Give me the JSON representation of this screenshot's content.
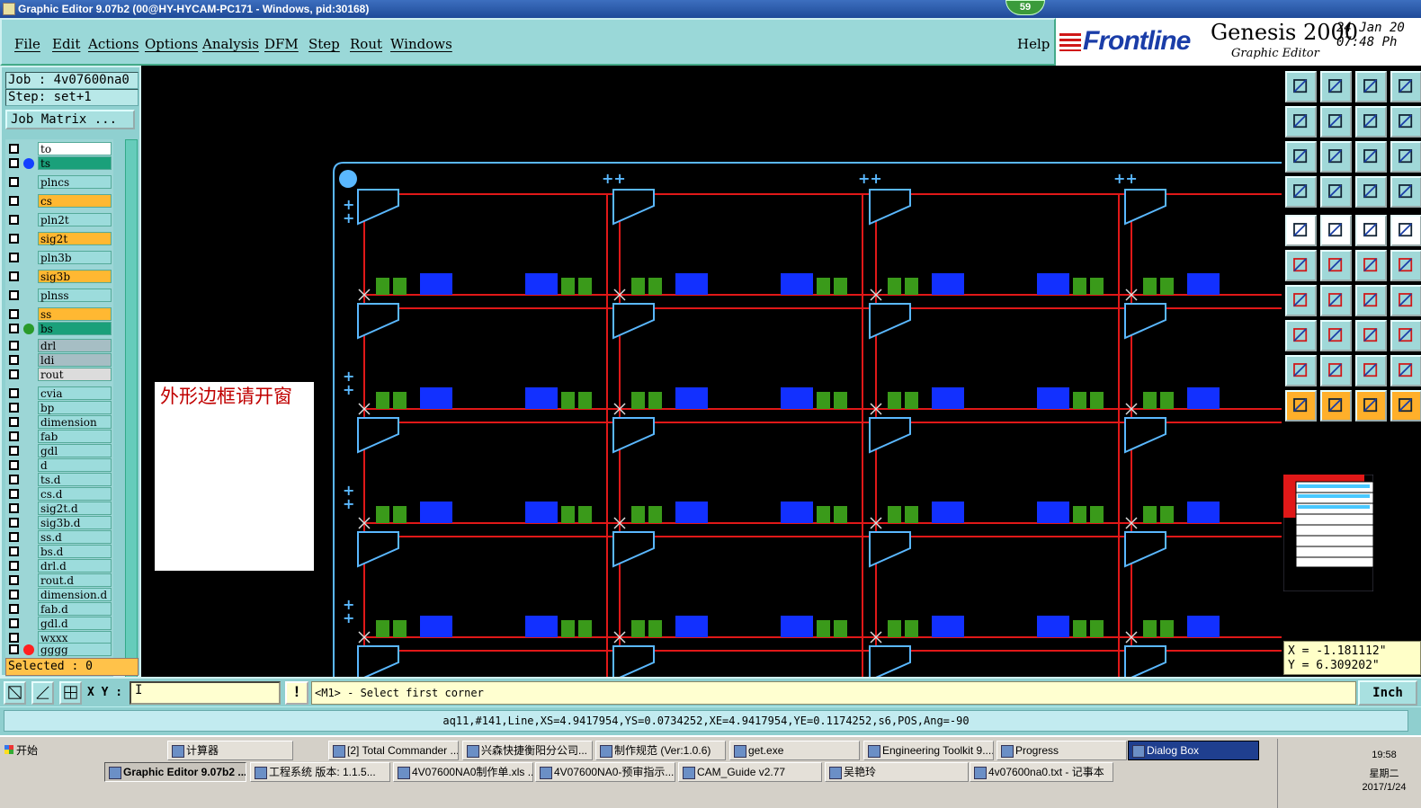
{
  "window": {
    "title": "Graphic Editor 9.07b2 (00@HY-HYCAM-PC171 - Windows, pid:30168)",
    "badge": "59"
  },
  "menu": {
    "items": [
      "File",
      "Edit",
      "Actions",
      "Options",
      "Analysis",
      "DFM",
      "Step",
      "Rout",
      "Windows"
    ],
    "help": "Help"
  },
  "brand": {
    "logo": "Frontline",
    "product": "Genesis 2000",
    "subtitle": "Graphic Editor",
    "date": "24 Jan 20",
    "time": "07:48 Ph"
  },
  "job": {
    "job_line": "Job : 4v07600na0",
    "step_line": "Step: set+1",
    "matrix_button": "Job Matrix ...",
    "selected": "Selected : 0"
  },
  "layers": [
    {
      "name": "to",
      "bg": "#ffffff",
      "dot": ""
    },
    {
      "name": "ts",
      "bg": "#1aa07a",
      "dot": "#1240ff"
    },
    {
      "name": "plncs",
      "bg": "#9cdcdc",
      "dot": ""
    },
    {
      "name": "cs",
      "bg": "#ffb832",
      "dot": ""
    },
    {
      "name": "pln2t",
      "bg": "#9cdcdc",
      "dot": ""
    },
    {
      "name": "sig2t",
      "bg": "#ffb832",
      "dot": ""
    },
    {
      "name": "pln3b",
      "bg": "#9cdcdc",
      "dot": ""
    },
    {
      "name": "sig3b",
      "bg": "#ffb832",
      "dot": ""
    },
    {
      "name": "plnss",
      "bg": "#9cdcdc",
      "dot": ""
    },
    {
      "name": "ss",
      "bg": "#ffb832",
      "dot": ""
    },
    {
      "name": "bs",
      "bg": "#1aa07a",
      "dot": "#2a9a2a"
    },
    {
      "name": "drl",
      "bg": "#a6bec4",
      "dot": ""
    },
    {
      "name": "ldi",
      "bg": "#a6bec4",
      "dot": ""
    },
    {
      "name": "rout",
      "bg": "#dcdcdc",
      "dot": ""
    },
    {
      "name": "cvia",
      "bg": "#9cdcdc",
      "dot": ""
    },
    {
      "name": "bp",
      "bg": "#9cdcdc",
      "dot": ""
    },
    {
      "name": "dimension",
      "bg": "#9cdcdc",
      "dot": ""
    },
    {
      "name": "fab",
      "bg": "#9cdcdc",
      "dot": ""
    },
    {
      "name": "gdl",
      "bg": "#9cdcdc",
      "dot": ""
    },
    {
      "name": "d",
      "bg": "#9cdcdc",
      "dot": ""
    },
    {
      "name": "ts.d",
      "bg": "#9cdcdc",
      "dot": ""
    },
    {
      "name": "cs.d",
      "bg": "#9cdcdc",
      "dot": ""
    },
    {
      "name": "sig2t.d",
      "bg": "#9cdcdc",
      "dot": ""
    },
    {
      "name": "sig3b.d",
      "bg": "#9cdcdc",
      "dot": ""
    },
    {
      "name": "ss.d",
      "bg": "#9cdcdc",
      "dot": ""
    },
    {
      "name": "bs.d",
      "bg": "#9cdcdc",
      "dot": ""
    },
    {
      "name": "drl.d",
      "bg": "#9cdcdc",
      "dot": ""
    },
    {
      "name": "rout.d",
      "bg": "#9cdcdc",
      "dot": ""
    },
    {
      "name": "dimension.d",
      "bg": "#9cdcdc",
      "dot": ""
    },
    {
      "name": "fab.d",
      "bg": "#9cdcdc",
      "dot": ""
    },
    {
      "name": "gdl.d",
      "bg": "#9cdcdc",
      "dot": ""
    },
    {
      "name": "wxxx",
      "bg": "#9cdcdc",
      "dot": ""
    },
    {
      "name": "gggg",
      "bg": "#9cdcdc",
      "dot": "#ff2020"
    }
  ],
  "canvas": {
    "note": "外形边框请开窗"
  },
  "coords": {
    "x": "X = -1.181112\"",
    "y": "Y = 6.309202\""
  },
  "command": {
    "xy_label": "X Y :",
    "xy_value": "I",
    "prompt": "<M1> - Select first corner",
    "units": "Inch"
  },
  "status": "aq11,#141,Line,XS=4.9417954,YS=0.0734252,XE=4.9417954,YE=0.1174252,s6,POS,Ang=-90",
  "taskbar": {
    "start": "开始",
    "row1": [
      "计算器",
      "[2] Total Commander ...",
      "兴森快捷衡阳分公司...",
      "制作规范 (Ver:1.0.6)",
      "get.exe",
      "Engineering Toolkit 9....",
      "Progress",
      "Dialog Box"
    ],
    "row2": [
      "Graphic Editor 9.07b2 ...",
      "工程系统  版本: 1.1.5...",
      "4V07600NA0制作单.xls ...",
      "4V07600NA0-预审指示....",
      "CAM_Guide v2.77",
      "吴艳玲",
      "4v07600na0.txt - 记事本"
    ],
    "clock_time": "19:58",
    "clock_day": "星期二",
    "clock_date": "2017/1/24"
  },
  "colors": {
    "trace": "#e01818",
    "outline": "#5ab8ff",
    "pad_green": "#3a9a1a",
    "pad_blue": "#1230ff"
  }
}
